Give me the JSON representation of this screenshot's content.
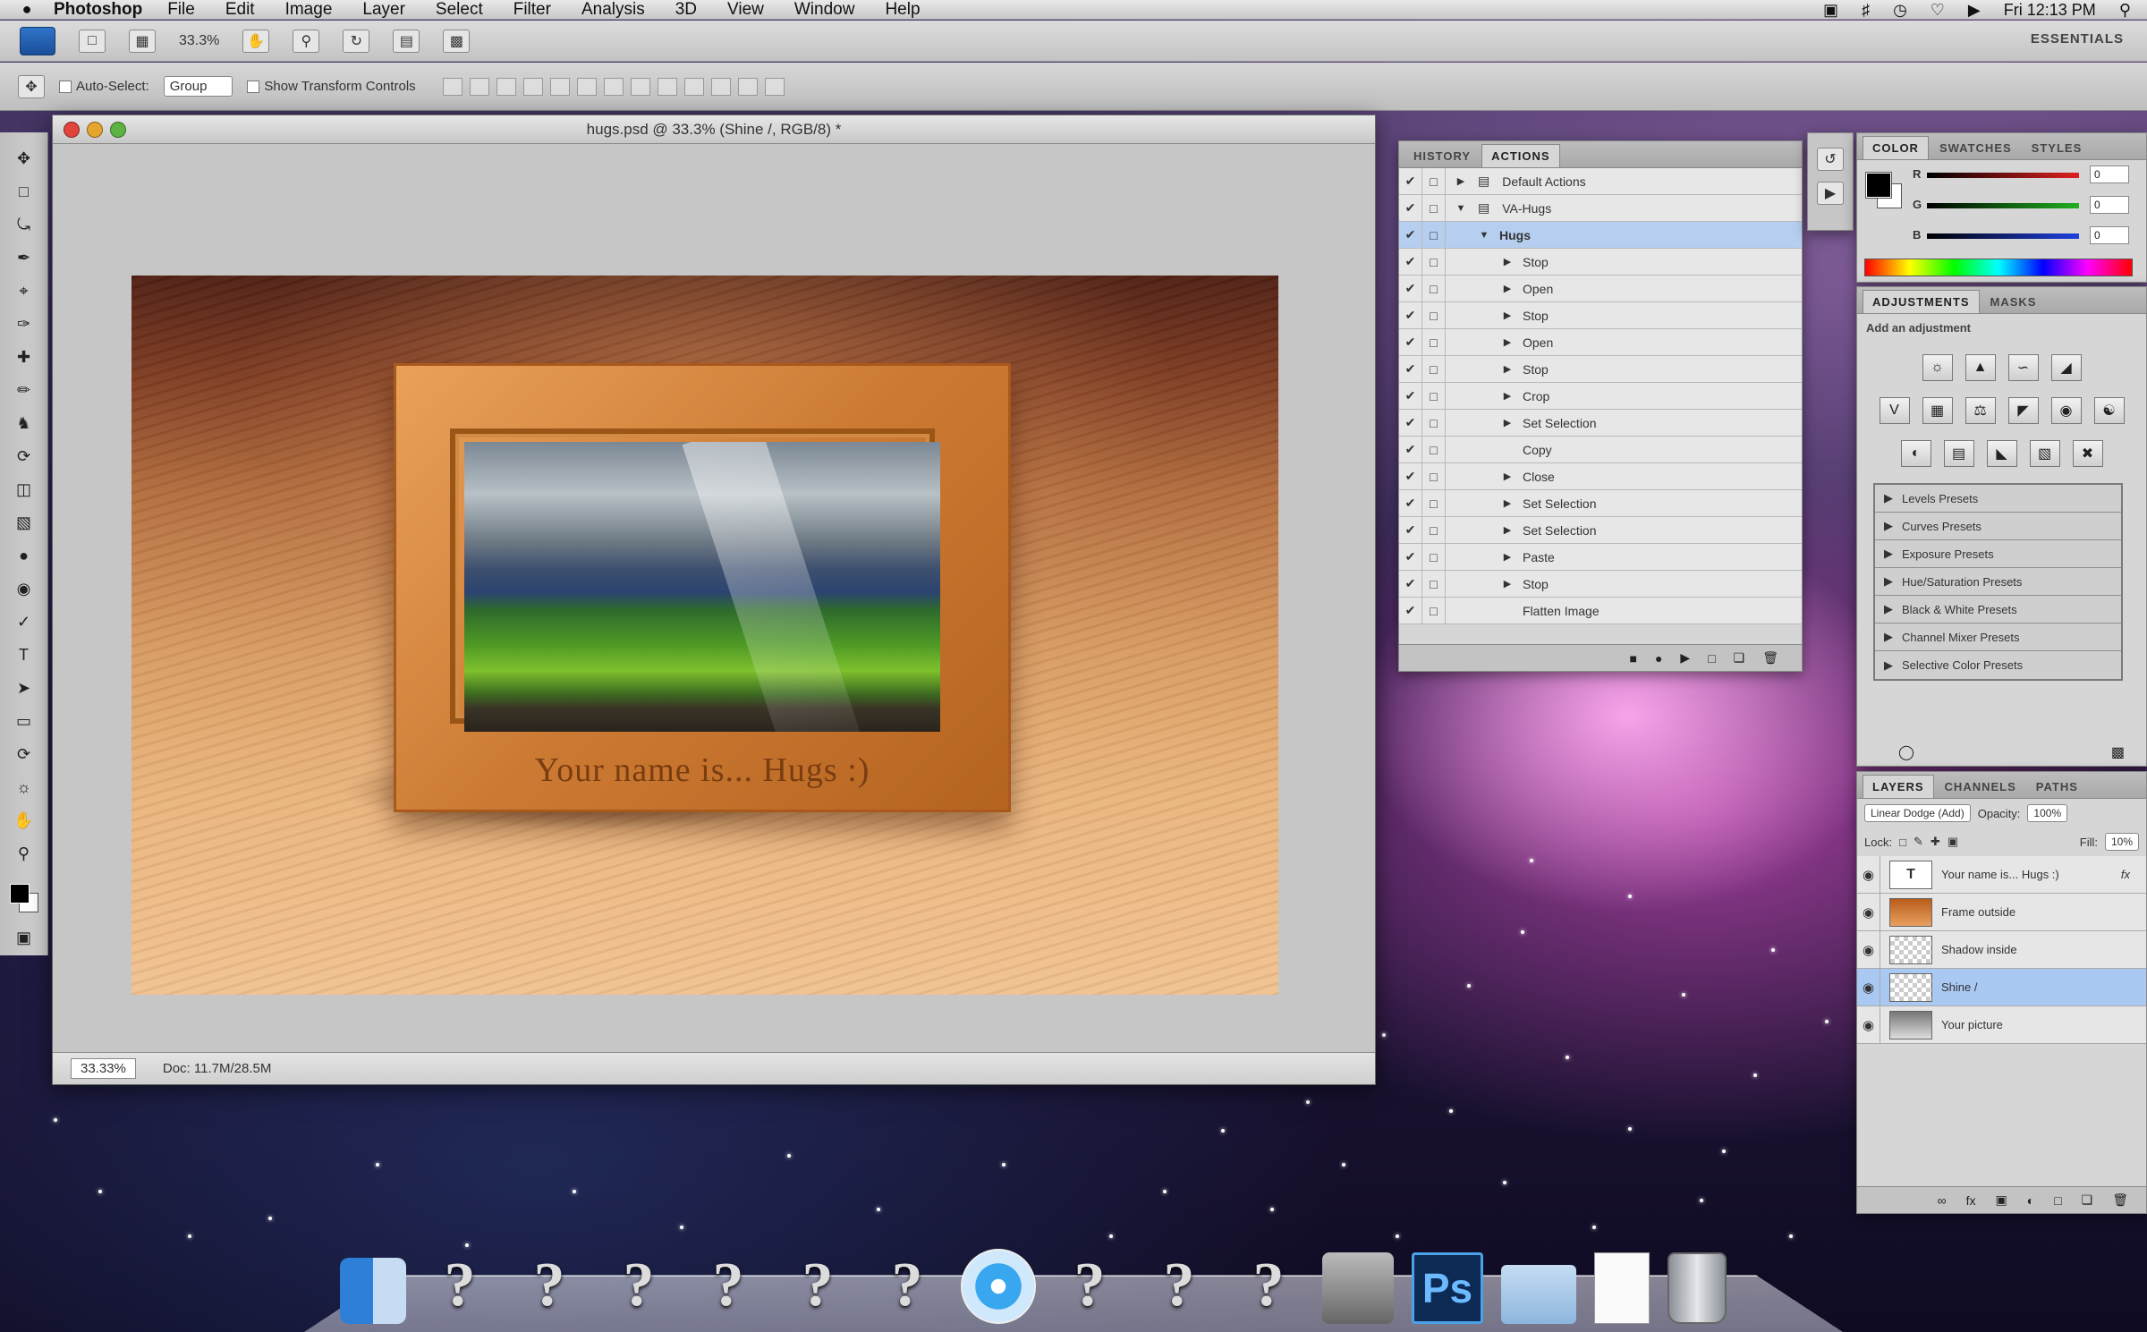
{
  "menubar": {
    "apple_icon": "apple-icon",
    "app_name": "Photoshop",
    "items": [
      "File",
      "Edit",
      "Image",
      "Layer",
      "Select",
      "Filter",
      "Analysis",
      "3D",
      "View",
      "Window",
      "Help"
    ],
    "clock": "Fri 12:13 PM"
  },
  "appbar": {
    "zoom": "33.3%",
    "workspace": "ESSENTIALS"
  },
  "options": {
    "auto_select": "Auto-Select:",
    "auto_select_value": "Group",
    "show_transform": "Show Transform Controls"
  },
  "document": {
    "title": "hugs.psd @ 33.3% (Shine /, RGB/8) *",
    "frame_text": "Your name is... Hugs :)",
    "status_zoom": "33.33%",
    "status_doc": "Doc: 11.7M/28.5M"
  },
  "actions_panel": {
    "tabs": [
      "HISTORY",
      "ACTIONS"
    ],
    "active_tab": "ACTIONS",
    "rows": [
      {
        "label": "Default Actions",
        "level": 0,
        "expand": "right",
        "selected": false
      },
      {
        "label": "VA-Hugs",
        "level": 0,
        "expand": "down",
        "selected": false
      },
      {
        "label": "Hugs",
        "level": 1,
        "expand": "down",
        "selected": true
      },
      {
        "label": "Stop",
        "level": 2,
        "expand": "right",
        "selected": false
      },
      {
        "label": "Open",
        "level": 2,
        "expand": "right",
        "selected": false
      },
      {
        "label": "Stop",
        "level": 2,
        "expand": "right",
        "selected": false
      },
      {
        "label": "Open",
        "level": 2,
        "expand": "right",
        "selected": false
      },
      {
        "label": "Stop",
        "level": 2,
        "expand": "right",
        "selected": false
      },
      {
        "label": "Crop",
        "level": 2,
        "expand": "right",
        "selected": false
      },
      {
        "label": "Set Selection",
        "level": 2,
        "expand": "right",
        "selected": false
      },
      {
        "label": "Copy",
        "level": 2,
        "expand": "",
        "selected": false
      },
      {
        "label": "Close",
        "level": 2,
        "expand": "right",
        "selected": false
      },
      {
        "label": "Set Selection",
        "level": 2,
        "expand": "right",
        "selected": false
      },
      {
        "label": "Set Selection",
        "level": 2,
        "expand": "right",
        "selected": false
      },
      {
        "label": "Paste",
        "level": 2,
        "expand": "right",
        "selected": false
      },
      {
        "label": "Stop",
        "level": 2,
        "expand": "right",
        "selected": false
      },
      {
        "label": "Flatten Image",
        "level": 2,
        "expand": "",
        "selected": false
      }
    ]
  },
  "color_panel": {
    "tabs": [
      "COLOR",
      "SWATCHES",
      "STYLES"
    ],
    "active_tab": "COLOR",
    "channels": [
      {
        "label": "R",
        "value": "0",
        "color": "#e02020"
      },
      {
        "label": "G",
        "value": "0",
        "color": "#20b020"
      },
      {
        "label": "B",
        "value": "0",
        "color": "#2040e0"
      }
    ]
  },
  "adjustments_panel": {
    "tabs": [
      "ADJUSTMENTS",
      "MASKS"
    ],
    "active_tab": "ADJUSTMENTS",
    "hint": "Add an adjustment",
    "presets": [
      "Levels Presets",
      "Curves Presets",
      "Exposure Presets",
      "Hue/Saturation Presets",
      "Black & White Presets",
      "Channel Mixer Presets",
      "Selective Color Presets"
    ]
  },
  "layers_panel": {
    "tabs": [
      "LAYERS",
      "CHANNELS",
      "PATHS"
    ],
    "active_tab": "LAYERS",
    "blend_mode": "Linear Dodge (Add)",
    "opacity_label": "Opacity:",
    "opacity": "100%",
    "lock_label": "Lock:",
    "fill_label": "Fill:",
    "fill": "10%",
    "layers": [
      {
        "name": "Your name is... Hugs :)",
        "thumb": "T",
        "fx": "fx",
        "selected": false
      },
      {
        "name": "Frame outside",
        "thumb": "",
        "fx": "",
        "selected": false
      },
      {
        "name": "Shadow inside",
        "thumb": "",
        "fx": "",
        "selected": false
      },
      {
        "name": "Shine /",
        "thumb": "",
        "fx": "",
        "selected": true
      },
      {
        "name": "Your picture",
        "thumb": "",
        "fx": "",
        "selected": false
      }
    ]
  },
  "dock": {
    "ps_label": "Ps",
    "placeholder_glyph": "?"
  }
}
